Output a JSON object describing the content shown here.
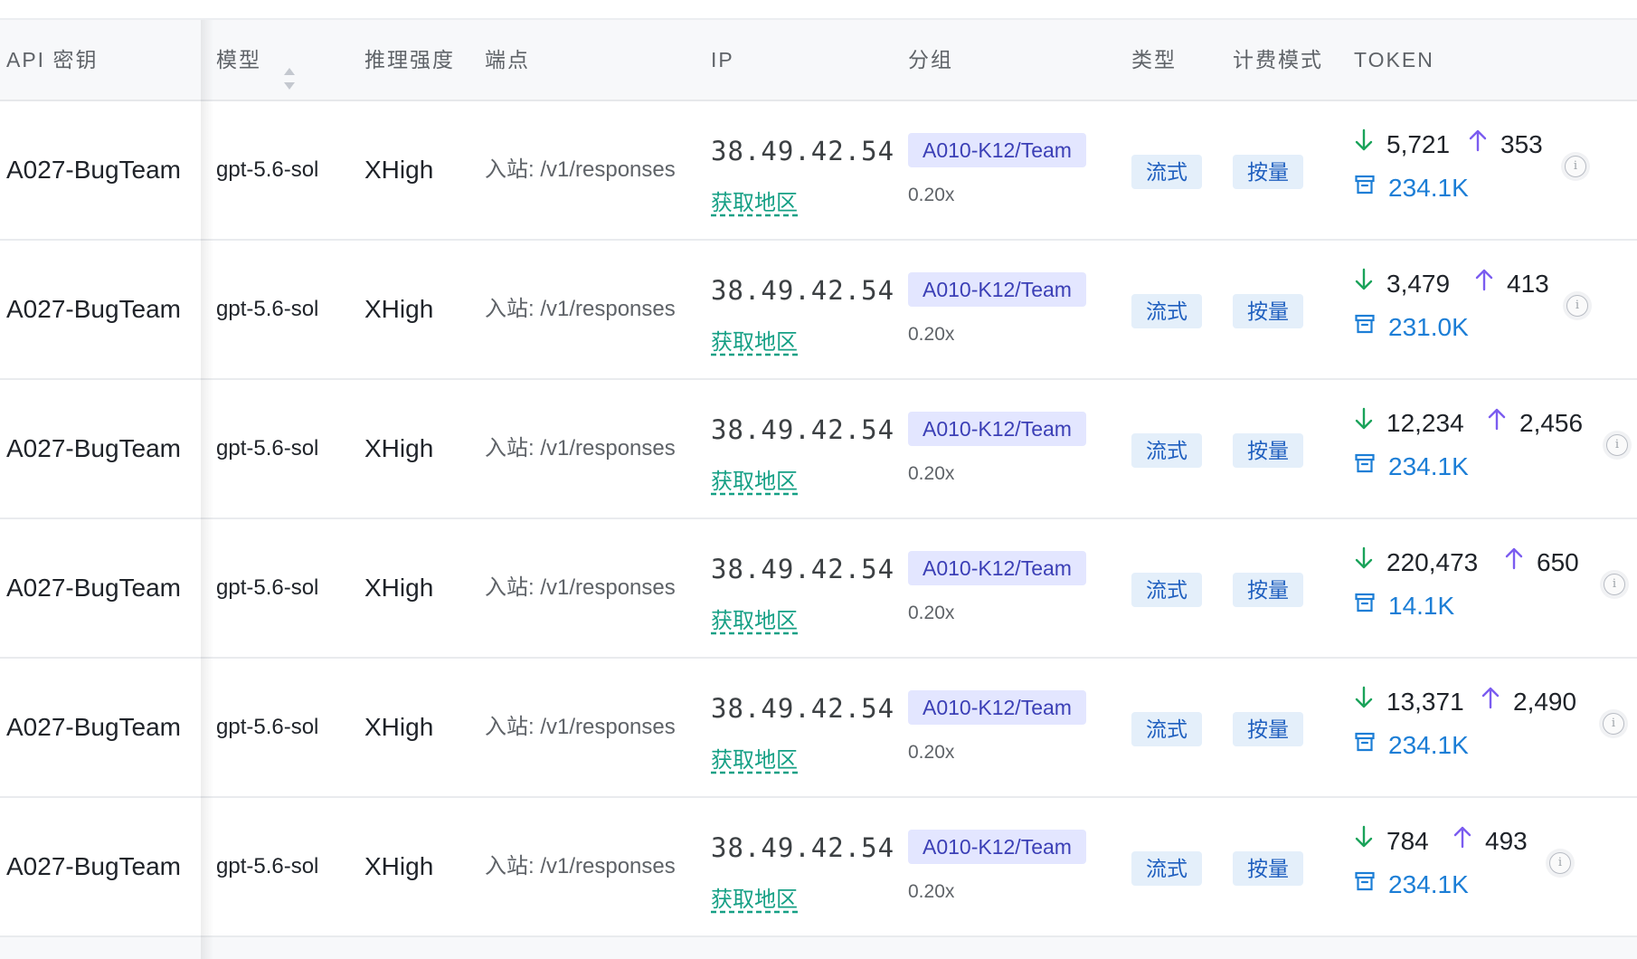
{
  "header": {
    "api_key": "API 密钥",
    "model": "模型",
    "effort": "推理强度",
    "endpoint": "端点",
    "ip": "IP",
    "group": "分组",
    "type": "类型",
    "billing": "计费模式",
    "token": "TOKEN"
  },
  "rows": [
    {
      "key": "A027-BugTeam",
      "model": "gpt-5.6-sol",
      "effort": "XHigh",
      "endpoint": "入站: /v1/responses",
      "ip": "38.49.42.54",
      "region": "获取地区",
      "group": "A010-K12/Team",
      "ratio": "0.20x",
      "type": "流式",
      "billing": "按量",
      "input": "5,721",
      "output": "353",
      "cache": "234.1K"
    },
    {
      "key": "A027-BugTeam",
      "model": "gpt-5.6-sol",
      "effort": "XHigh",
      "endpoint": "入站: /v1/responses",
      "ip": "38.49.42.54",
      "region": "获取地区",
      "group": "A010-K12/Team",
      "ratio": "0.20x",
      "type": "流式",
      "billing": "按量",
      "input": "3,479",
      "output": "413",
      "cache": "231.0K"
    },
    {
      "key": "A027-BugTeam",
      "model": "gpt-5.6-sol",
      "effort": "XHigh",
      "endpoint": "入站: /v1/responses",
      "ip": "38.49.42.54",
      "region": "获取地区",
      "group": "A010-K12/Team",
      "ratio": "0.20x",
      "type": "流式",
      "billing": "按量",
      "input": "12,234",
      "output": "2,456",
      "cache": "234.1K"
    },
    {
      "key": "A027-BugTeam",
      "model": "gpt-5.6-sol",
      "effort": "XHigh",
      "endpoint": "入站: /v1/responses",
      "ip": "38.49.42.54",
      "region": "获取地区",
      "group": "A010-K12/Team",
      "ratio": "0.20x",
      "type": "流式",
      "billing": "按量",
      "input": "220,473",
      "output": "650",
      "cache": "14.1K"
    },
    {
      "key": "A027-BugTeam",
      "model": "gpt-5.6-sol",
      "effort": "XHigh",
      "endpoint": "入站: /v1/responses",
      "ip": "38.49.42.54",
      "region": "获取地区",
      "group": "A010-K12/Team",
      "ratio": "0.20x",
      "type": "流式",
      "billing": "按量",
      "input": "13,371",
      "output": "2,490",
      "cache": "234.1K"
    },
    {
      "key": "A027-BugTeam",
      "model": "gpt-5.6-sol",
      "effort": "XHigh",
      "endpoint": "入站: /v1/responses",
      "ip": "38.49.42.54",
      "region": "获取地区",
      "group": "A010-K12/Team",
      "ratio": "0.20x",
      "type": "流式",
      "billing": "按量",
      "input": "784",
      "output": "493",
      "cache": "234.1K"
    }
  ],
  "icons": {
    "sort": "sort-icon",
    "input_tokens": "arrow-down-icon",
    "output_tokens": "arrow-up-icon",
    "cache_tokens": "archive-box-icon",
    "details": "info-icon"
  },
  "colors": {
    "input_arrow": "#1aa35a",
    "output_arrow": "#7b5cf0",
    "cache": "#1c7ed6",
    "region_link": "#16a085",
    "group_tag_bg": "#e3e6ff",
    "group_tag_fg": "#3b3fb6",
    "type_tag_bg": "#e4effa",
    "type_tag_fg": "#1f5fbf"
  }
}
